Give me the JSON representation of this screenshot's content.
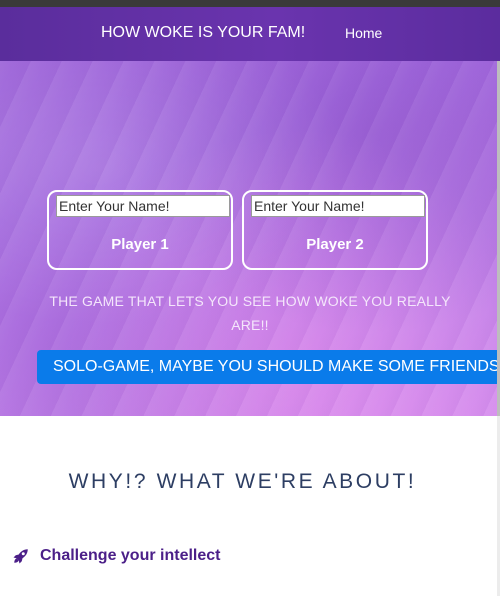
{
  "navbar": {
    "brand": "HOW WOKE IS YOUR FAM!",
    "home_label": "Home",
    "background": "#6a34ae"
  },
  "hero": {
    "players": [
      {
        "label": "Player 1",
        "name_placeholder": "Enter Your Name!"
      },
      {
        "label": "Player 2",
        "name_placeholder": "Enter Your Name!"
      }
    ],
    "tagline": "THE GAME THAT LETS YOU SEE HOW WOKE YOU REALLY ARE!!",
    "solo_button_label": "SOLO-GAME, MAYBE YOU SHOULD MAKE SOME FRIENDS",
    "accent": "#0a7bea"
  },
  "about": {
    "title": "WHY!? WHAT WE'RE ABOUT!",
    "features": [
      {
        "icon": "rocket-icon",
        "label": "Challenge your intellect"
      }
    ]
  }
}
